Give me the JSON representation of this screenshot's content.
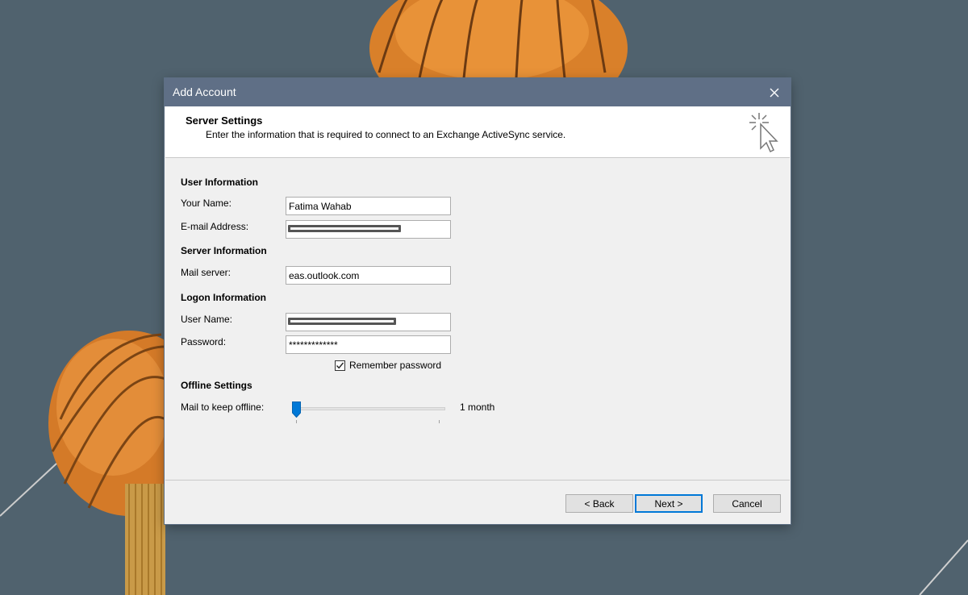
{
  "dialog": {
    "title": "Add Account",
    "header": {
      "title": "Server Settings",
      "subtitle": "Enter the information that is required to connect to an Exchange ActiveSync service."
    },
    "user_information": {
      "heading": "User Information",
      "your_name_label": "Your Name:",
      "your_name_value": "Fatima Wahab",
      "email_label": "E-mail Address:"
    },
    "server_information": {
      "heading": "Server Information",
      "mail_server_label": "Mail server:",
      "mail_server_value": "eas.outlook.com"
    },
    "logon_information": {
      "heading": "Logon Information",
      "user_name_label": "User Name:",
      "password_label": "Password:",
      "password_value": "*************",
      "remember_password_label": "Remember password",
      "remember_password_checked": true
    },
    "offline_settings": {
      "heading": "Offline Settings",
      "mail_to_keep_label": "Mail to keep offline:",
      "mail_to_keep_value": "1 month",
      "slider_position": 0
    },
    "buttons": {
      "back": "< Back",
      "next": "Next >",
      "cancel": "Cancel"
    }
  },
  "colors": {
    "titlebar": "#5f6f86",
    "accent": "#0078d7",
    "desktop": "#50626e",
    "lantern": "#e08a2e"
  }
}
